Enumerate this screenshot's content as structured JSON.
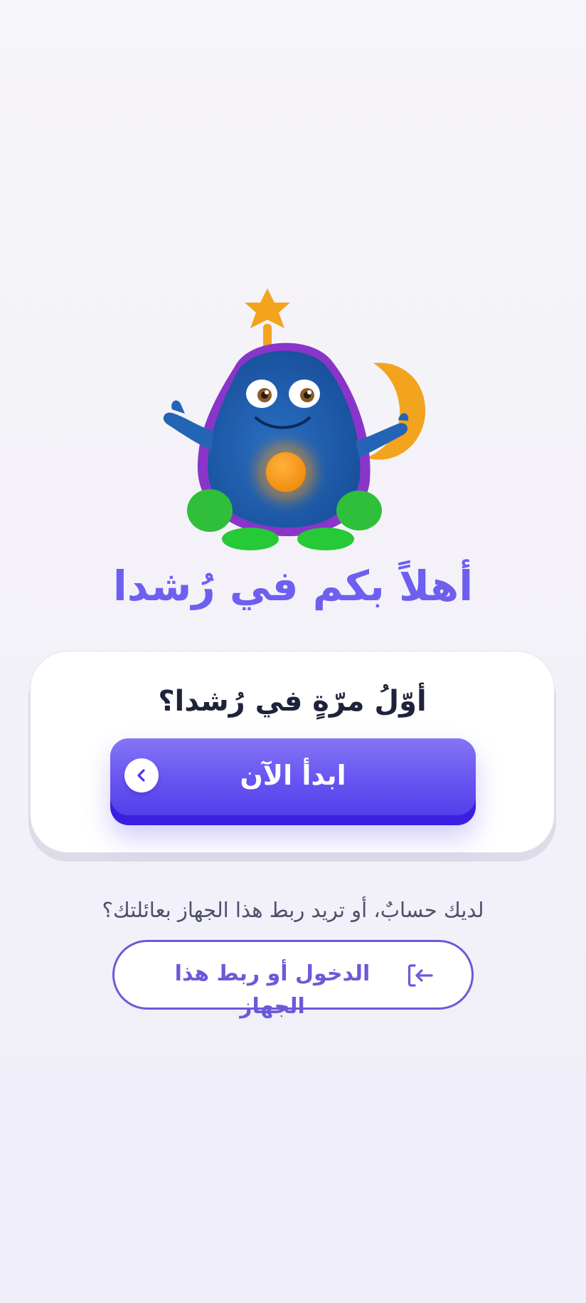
{
  "welcome": {
    "title": "أهلاً بكم في رُشدا"
  },
  "mascot": {
    "icon": "mascot-character"
  },
  "first_time_card": {
    "question": "أوّلُ مرّةٍ في رُشدا؟",
    "start_button_label": "ابدأ الآن",
    "start_icon": "chevron-left-icon"
  },
  "account": {
    "prompt": "لديك حسابٌ، أو تريد ربط هذا الجهاز بعائلتك؟",
    "login_button_label": "الدخول أو ربط هذا الجهاز",
    "login_icon": "login-arrow-icon"
  },
  "colors": {
    "accent": "#6e5ff0",
    "button_primary": "#6754f0",
    "button_bottom": "#3a1fe0",
    "text_dark": "#1f2339",
    "text_muted": "#4c5068",
    "outline": "#6a5ad8"
  }
}
